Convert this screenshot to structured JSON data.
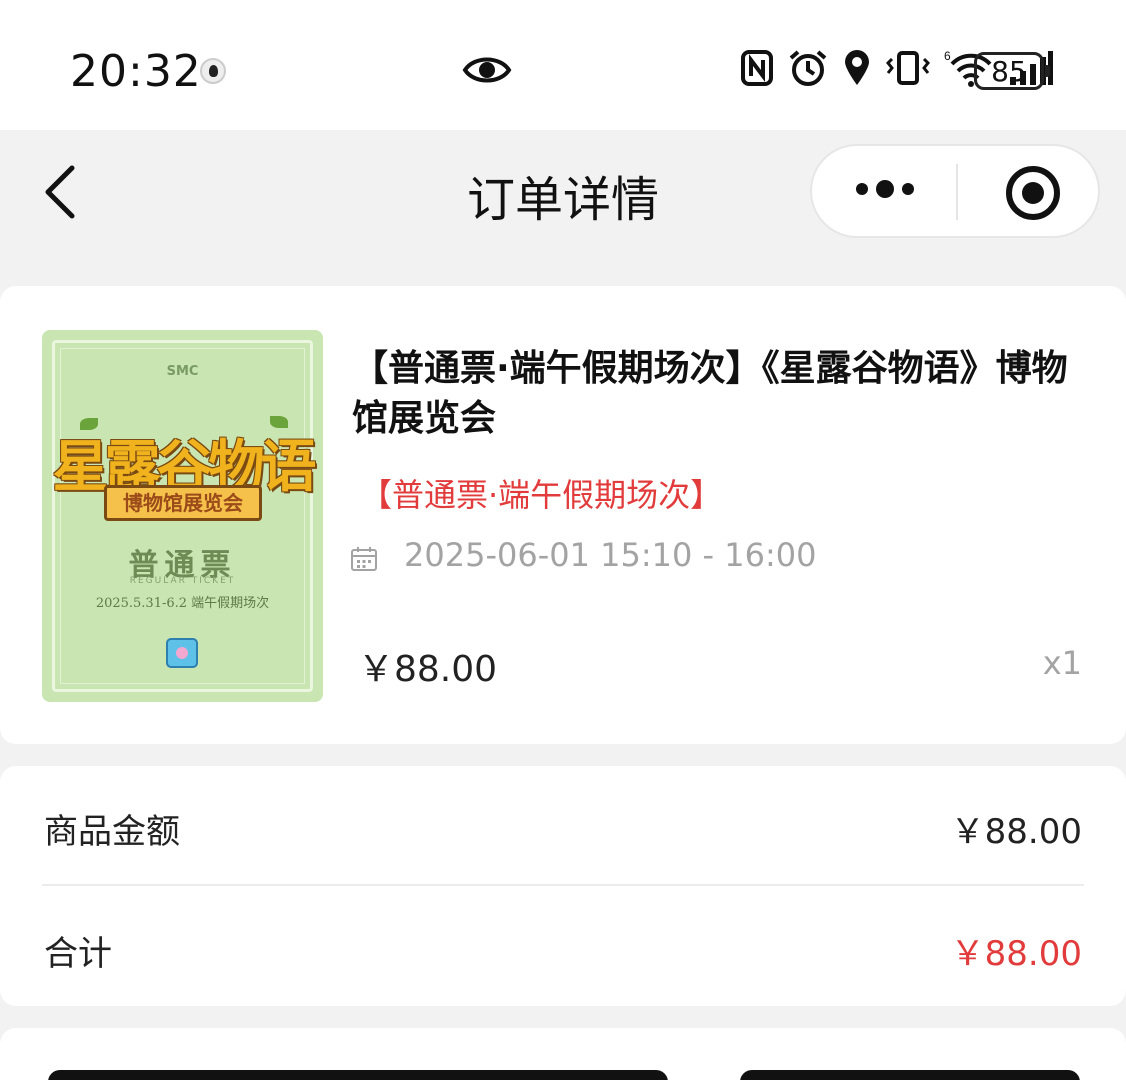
{
  "status_bar": {
    "time": "20:32",
    "icons": [
      "qq-icon",
      "eye-icon",
      "nfc-icon",
      "alarm-icon",
      "location-icon",
      "vibrate-icon",
      "wifi-icon",
      "signal-icon",
      "battery-icon"
    ],
    "battery": "85"
  },
  "nav": {
    "title": "订单详情",
    "icons": [
      "back-icon",
      "more-icon",
      "close-target-icon"
    ]
  },
  "product": {
    "title": "【普通票·端午假期场次】《星露谷物语》博物馆展览会",
    "variant": "【普通票·端午假期场次】",
    "datetime": "2025-06-01 15:10 - 16:00",
    "price": "￥88.00",
    "quantity": "x1",
    "image": {
      "brand": "SMC",
      "title": "星露谷物语",
      "subtitle": "博物馆展览会",
      "ticket_type": "普通票",
      "ticket_type_en": "REGULAR TICKET",
      "dates": "2025.5.31-6.2 端午假期场次"
    }
  },
  "summary": {
    "goods_amount_label": "商品金额",
    "goods_amount_value": "￥88.00",
    "total_label": "合计",
    "total_value": "￥88.00"
  },
  "colors": {
    "accent_red": "#e23b3b",
    "muted": "#a3a3a3",
    "background": "#f2f2f2"
  }
}
